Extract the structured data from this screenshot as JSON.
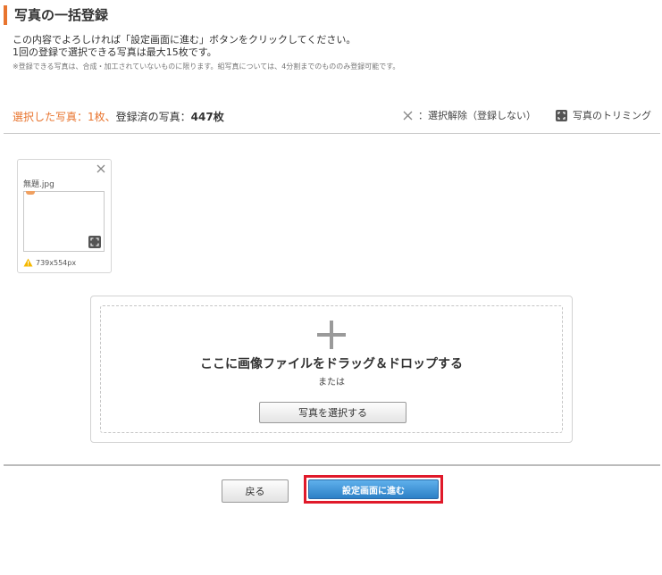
{
  "page": {
    "title": "写真の一括登録",
    "description_line1": "この内容でよろしければ「設定画面に進む」ボタンをクリックしてください。",
    "description_line2": "1回の登録で選択できる写真は最大15枚です。",
    "note": "※登録できる写真は、合成・加工されていないものに限ります。組写真については、4分割までのもののみ登録可能です。"
  },
  "status": {
    "selected_label": "選択した写真：1枚、",
    "registered_label": "登録済の写真：",
    "registered_count": "447枚"
  },
  "actions": {
    "deselect_label": "：選択解除（登録しない）",
    "trim_label": "写真のトリミング"
  },
  "photos": [
    {
      "filename": "無題.jpg",
      "dimensions": "739x554px"
    }
  ],
  "dropzone": {
    "title": "ここに画像ファイルをドラッグ＆ドロップする",
    "or_text": "または",
    "select_button": "写真を選択する"
  },
  "footer": {
    "back_button": "戻る",
    "next_button": "設定画面に進む"
  },
  "colors": {
    "accent": "#e8742e",
    "primary_button": "#2c80c6",
    "highlight_frame": "#e0192a",
    "warning": "#f5b800"
  }
}
